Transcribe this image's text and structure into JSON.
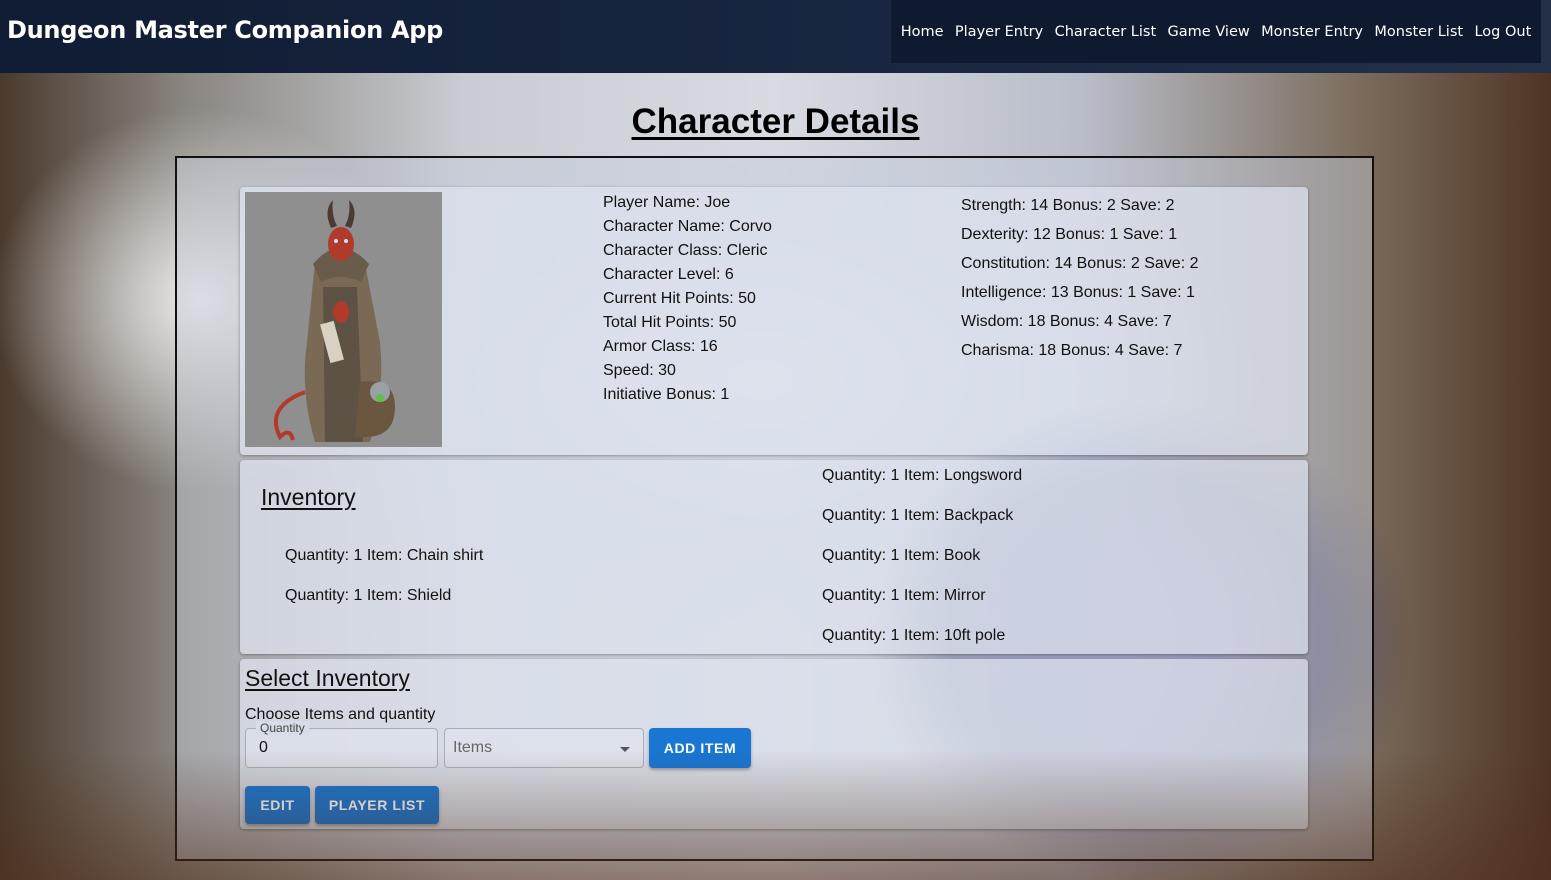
{
  "header": {
    "app_title": "Dungeon Master Companion App",
    "nav": [
      "Home",
      "Player Entry",
      "Character List",
      "Game View",
      "Monster Entry",
      "Monster List",
      "Log Out"
    ]
  },
  "page_title": "Character Details",
  "character": {
    "basic": [
      "Player Name: Joe",
      "Character Name: Corvo",
      "Character Class: Cleric",
      "Character Level: 6",
      "Current Hit Points: 50",
      "Total Hit Points: 50",
      "Armor Class: 16",
      "Speed: 30",
      "Initiative Bonus: 1"
    ],
    "abilities": [
      "Strength: 14 Bonus: 2 Save: 2",
      "Dexterity: 12 Bonus: 1 Save: 1",
      "Constitution: 14 Bonus: 2 Save: 2",
      "Intelligence: 13 Bonus: 1 Save: 1",
      "Wisdom: 18 Bonus: 4 Save: 7",
      "Charisma: 18 Bonus: 4 Save: 7"
    ]
  },
  "inventory": {
    "title": "Inventory",
    "left_items": [
      "Quantity: 1 Item: Chain shirt",
      "Quantity: 1 Item: Shield"
    ],
    "right_items": [
      "Quantity: 1 Item: Longsword",
      "Quantity: 1 Item: Backpack",
      "Quantity: 1 Item: Book",
      "Quantity: 1 Item: Mirror",
      "Quantity: 1 Item: 10ft pole"
    ]
  },
  "select_inventory": {
    "title": "Select Inventory",
    "subtitle": "Choose Items and quantity",
    "quantity_label": "Quantity",
    "quantity_value": "0",
    "items_placeholder": "Items",
    "add_button": "ADD ITEM",
    "edit_button": "EDIT",
    "player_list_button": "PLAYER LIST"
  }
}
